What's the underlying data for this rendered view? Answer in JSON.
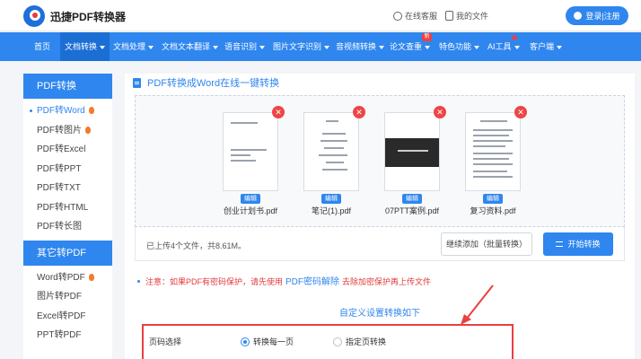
{
  "header": {
    "logo_text": "迅捷PDF转换器",
    "service_label": "在线客服",
    "my_files_label": "我的文件",
    "login_label": "登录|注册"
  },
  "nav": {
    "items": [
      {
        "label": "首页"
      },
      {
        "label": "文档转换"
      },
      {
        "label": "文档处理"
      },
      {
        "label": "文档文本翻译"
      },
      {
        "label": "语音识别"
      },
      {
        "label": "图片文字识别"
      },
      {
        "label": "音视频转换"
      },
      {
        "label": "论文查重"
      },
      {
        "label": "特色功能"
      },
      {
        "label": "AI工具"
      },
      {
        "label": "客户端"
      }
    ],
    "new_badge": "新"
  },
  "sidebar": {
    "section1_title": "PDF转换",
    "section1_items": [
      "PDF转Word",
      "PDF转图片",
      "PDF转Excel",
      "PDF转PPT",
      "PDF转TXT",
      "PDF转HTML",
      "PDF转长图"
    ],
    "section2_title": "其它转PDF",
    "section2_items": [
      "Word转PDF",
      "图片转PDF",
      "Excel转PDF",
      "PPT转PDF"
    ]
  },
  "main": {
    "title": "PDF转换成Word在线一键转换",
    "files": [
      {
        "name": "创业计划书.pdf",
        "edit": "编辑"
      },
      {
        "name": "笔记(1).pdf",
        "edit": "编辑"
      },
      {
        "name": "07PTT案例.pdf",
        "edit": "编辑"
      },
      {
        "name": "复习资料.pdf",
        "edit": "编辑"
      }
    ],
    "upload_count": "已上传4个文件，共8.61M。",
    "add_button": "继续添加（批量转换）",
    "start_button": "开始转换",
    "notice_prefix": "注意：如果PDF有密码保护，请先使用",
    "notice_link": "PDF密码解除",
    "notice_suffix": "去除加密保护再上传文件",
    "custom_title": "自定义设置转换如下",
    "page_select_label": "页码选择",
    "radio_all": "转换每一页",
    "radio_specific": "指定页转换"
  },
  "colors": {
    "accent": "#2f86ee",
    "danger": "#e84040"
  }
}
